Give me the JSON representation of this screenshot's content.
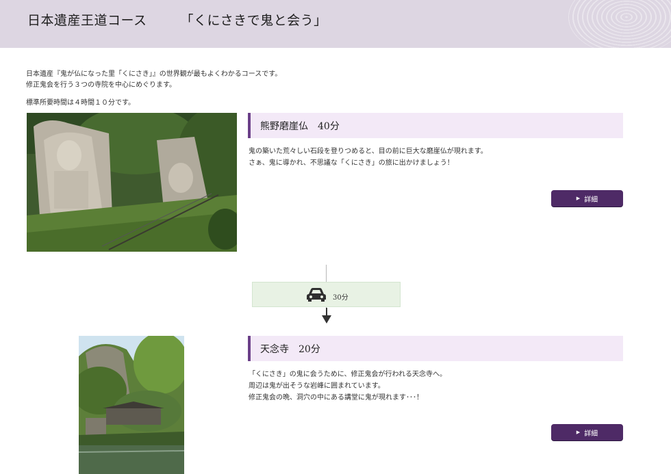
{
  "header": {
    "title": "日本遺産王道コース　　　「くにさきで鬼と会う」"
  },
  "intro": {
    "line1": "日本遺産『鬼が仏になった里「くにさき」』の世界観が最もよくわかるコースです。",
    "line2": "修正鬼会を行う３つの寺院を中心にめぐります。",
    "time": "標準所要時間は４時間１０分です。"
  },
  "spots": [
    {
      "heading": "熊野磨崖仏　40分",
      "desc": [
        "鬼の築いた荒々しい石段を登りつめると、目の前に巨大な磨崖仏が現れます。",
        "さぁ、鬼に導かれ、不思議な「くにさき」の旅に出かけましょう！"
      ],
      "button": "詳細"
    },
    {
      "heading": "天念寺　20分",
      "desc": [
        "「くにさき」の鬼に会うために、修正鬼会が行われる天念寺へ。",
        "周辺は鬼が出そうな岩峰に囲まれています。",
        "修正鬼会の晩、洞穴の中にある講堂に鬼が現れます･･･！"
      ],
      "button": "詳細"
    }
  ],
  "transport": {
    "icon": "car-icon",
    "time": "30分"
  },
  "colors": {
    "header_bg": "#ddd6e2",
    "accent": "#6a3f88",
    "button_bg": "#4e2a66",
    "heading_bg": "#f3e9f7",
    "transport_bg": "#e8f2e4"
  }
}
